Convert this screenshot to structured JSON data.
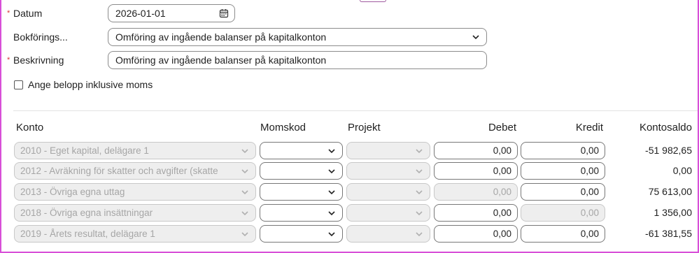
{
  "form": {
    "datum_label": "Datum",
    "datum_value": "2026-01-01",
    "bokforing_label": "Bokförings...",
    "bokforing_value": "Omföring av ingående balanser på kapitalkonton",
    "beskrivning_label": "Beskrivning",
    "beskrivning_value": "Omföring av ingående balanser på kapitalkonton",
    "moms_checkbox_label": "Ange belopp inklusive moms",
    "moms_checkbox_checked": false,
    "required_marker": "*"
  },
  "table": {
    "headers": {
      "konto": "Konto",
      "momskod": "Momskod",
      "projekt": "Projekt",
      "debet": "Debet",
      "kredit": "Kredit",
      "kontosaldo": "Kontosaldo"
    },
    "rows": [
      {
        "konto": "2010 - Eget kapital, delägare 1",
        "momskod": "",
        "projekt": "",
        "debet": "0,00",
        "debet_enabled": true,
        "kredit": "0,00",
        "kredit_enabled": true,
        "kontosaldo": "-51 982,65"
      },
      {
        "konto": "2012 - Avräkning för skatter och avgifter (skatte",
        "momskod": "",
        "projekt": "",
        "debet": "0,00",
        "debet_enabled": true,
        "kredit": "0,00",
        "kredit_enabled": true,
        "kontosaldo": "0,00"
      },
      {
        "konto": "2013 - Övriga egna uttag",
        "momskod": "",
        "projekt": "",
        "debet": "0,00",
        "debet_enabled": false,
        "kredit": "0,00",
        "kredit_enabled": true,
        "kontosaldo": "75 613,00"
      },
      {
        "konto": "2018 - Övriga egna insättningar",
        "momskod": "",
        "projekt": "",
        "debet": "0,00",
        "debet_enabled": true,
        "kredit": "0,00",
        "kredit_enabled": false,
        "kontosaldo": "1 356,00"
      },
      {
        "konto": "2019 - Årets resultat, delägare 1",
        "momskod": "",
        "projekt": "",
        "debet": "0,00",
        "debet_enabled": true,
        "kredit": "0,00",
        "kredit_enabled": true,
        "kontosaldo": "-61 381,55"
      }
    ]
  },
  "colors": {
    "required": "#d9383a",
    "frame": "#d84fd8",
    "disabled_bg": "#eeeeee",
    "disabled_text": "#a6a6a6"
  }
}
